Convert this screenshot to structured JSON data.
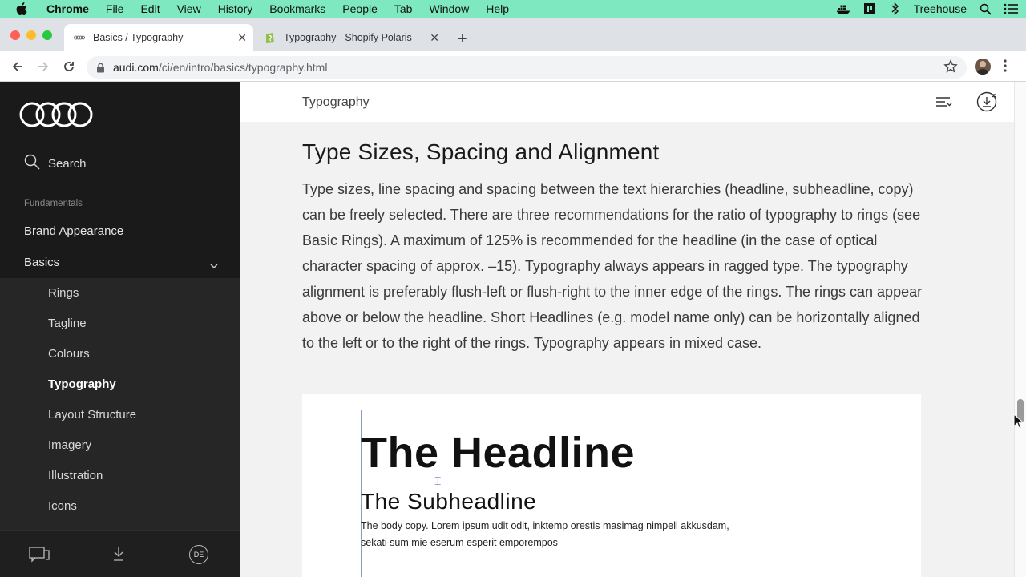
{
  "menubar": {
    "app": "Chrome",
    "items": [
      "File",
      "Edit",
      "View",
      "History",
      "Bookmarks",
      "People",
      "Tab",
      "Window",
      "Help"
    ],
    "user": "Treehouse",
    "icons": [
      "apple-icon",
      "docker-icon",
      "app-icon",
      "bluetooth-icon",
      "spotlight-search-icon",
      "control-center-icon"
    ]
  },
  "tabs": [
    {
      "title": "Basics / Typography",
      "icon": "audi-rings-icon",
      "active": true
    },
    {
      "title": "Typography - Shopify Polaris",
      "icon": "shopify-icon",
      "active": false
    }
  ],
  "url": {
    "host": "audi.com",
    "path": "/ci/en/intro/basics/typography.html"
  },
  "sidebar": {
    "search_label": "Search",
    "section_label": "Fundamentals",
    "items": [
      "Brand Appearance",
      "Basics"
    ],
    "subitems": [
      "Rings",
      "Tagline",
      "Colours",
      "Typography",
      "Layout Structure",
      "Imagery",
      "Illustration",
      "Icons"
    ],
    "active_subitem": "Typography",
    "footer_lang": "DE"
  },
  "main": {
    "breadcrumb": "Typography",
    "section_title": "Type Sizes, Spacing and Alignment",
    "paragraph": "Type sizes, line spacing and spacing between the text hierarchies (headline, subheadline, copy) can be freely selected. There are three recommendations for the ratio of typography to rings (see Basic Rings). A maximum of 125% is recommended for the headline (in the case of optical character spacing of approx. –15). Typography always appears in ragged type. The typography alignment is preferably flush-left or flush-right to the inner edge of the rings. The rings can appear above or below the headline. Short Headlines (e.g. model name only) can be horizontally aligned to the left or to the right of the rings. Typography appears in mixed case.",
    "sample": {
      "headline": "The Headline",
      "subheadline": "The Subheadline",
      "body": "The body copy. Lorem ipsum udit odit, inktemp orestis masimag nimpell akkusdam, sekati sum mie eserum esperit emporempos"
    }
  },
  "colors": {
    "menubar": "#7ee8c0",
    "sidebar": "#1a1a1a",
    "content_bg": "#f2f2f2"
  }
}
